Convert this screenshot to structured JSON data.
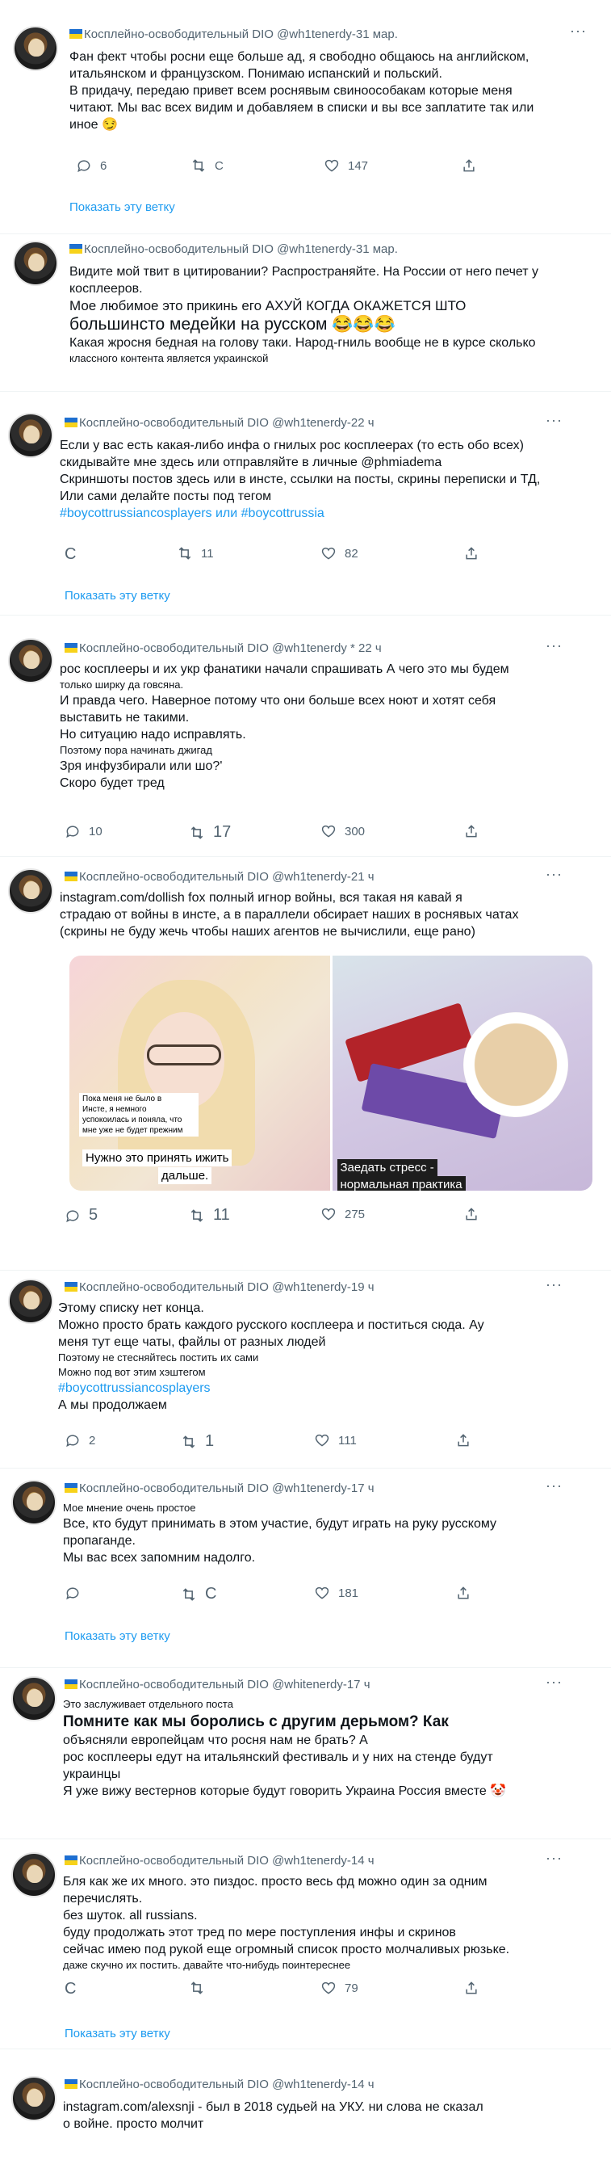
{
  "author": {
    "name": "Косплейно-освободительный DIO",
    "handles": [
      "@wh1tenerdy",
      "@whitenerdy"
    ]
  },
  "tweets": [
    {
      "header": "Косплейно-освободительный DIO @wh1tenerdy-31 мар.",
      "lines": [
        "Фан фект чтобы росни еще больше ад, я свободно общаюсь на английском,",
        "итальянском и французском. Понимаю испанский и польский.",
        "В придачу, передаю привет всем роснявым свиноособакам которые меня",
        "читают. Мы вас всех видим и добавляем в списки и вы все заплатите так или",
        "иное 😏"
      ],
      "counts": {
        "reply": "6",
        "retweet": "С",
        "like": "147"
      },
      "thread": "Показать эту ветку"
    },
    {
      "header": "Косплейно-освободительный DIO @wh1tenerdy-31 мар.",
      "lines": [
        "Видите мой твит в цитировании? Распространяйте. На России от него печет у",
        "косплееров.",
        "Мое любимое это прикинь его АХУЙ КОГДА ОКАЖЕТСЯ ШТО",
        "большинсто медейки на русском 😂😂😂",
        "Какая жросня бедная на голову таки. Народ-гниль вообще не в курсе сколько",
        "классного контента является украинской"
      ]
    },
    {
      "header": "Косплейно-освободительный DIO @wh1tenerdy-22 ч",
      "lines": [
        "Если у вас есть какая-либо инфа о гнилых рос косплеерах (то есть обо всех)",
        "скидывайте мне здесь или отправляйте в личные @phmiadema",
        "Скриншоты постов здесь или в инсте, ссылки на посты, скрины переписки и ТД,",
        "Или сами делайте посты под тегом",
        "#boycottrussiancosplayers или #boycottrussia"
      ],
      "counts": {
        "reply": "C",
        "retweet": "11",
        "like": "82"
      },
      "thread": "Показать эту ветку"
    },
    {
      "header": "Косплейно-освободительный DIO @wh1tenerdy * 22 ч",
      "lines": [
        "рос косплееры и их укр фанатики начали спрашивать А чего это мы будем",
        "только ширку да говсяна.",
        "И правда чего. Наверное потому что они больше всех ноют и хотят себя",
        "выставить не такими.",
        "Но ситуацию надо исправлять.",
        "Поэтому пора начинать джигад",
        "Зря инфузбирали или шо?'",
        "Скоро будет тред"
      ],
      "counts": {
        "reply": "10",
        "retweet": "17",
        "like": "300"
      }
    },
    {
      "header": "Косплейно-освободительный DIO @wh1tenerdy-21 ч",
      "lines": [
        "instagram.com/dollish fox полный игнор войны, вся такая ня кавай я",
        "страдаю от войны в инсте, а в параллели обсирает наших в роснявых чатах",
        "(скрины не буду жечь чтобы наших агентов не вычислили, еще рано)"
      ],
      "photo_captions": {
        "left_small": [
          "Пока меня не было в",
          "Инсте, я немного",
          "успокоилась и поняла, что",
          "мне уже не будет прежним"
        ],
        "left_big_1": "Нужно это принять",
        "left_big_2": "ижить",
        "left_big_3": "дальше.",
        "right_1": "Заедать стресс -",
        "right_2": "нормальная практика"
      },
      "counts": {
        "reply": "5",
        "retweet": "11",
        "like": "275"
      }
    },
    {
      "header": "Косплейно-освободительный DIO @wh1tenerdy-19 ч",
      "lines": [
        "Этому списку нет конца.",
        "Можно просто брать каждого русского косплеера и поститься сюда. Ау",
        "меня тут еще чаты, файлы от разных людей",
        "Поэтому не стесняйтесь постить их сами",
        "Можно под вот этим хэштегом",
        "#boycottrussiancosplayers",
        "А мы продолжаем"
      ],
      "counts": {
        "reply": "2",
        "retweet": "1",
        "like": "111"
      }
    },
    {
      "header": "Косплейно-освободительный DIO @wh1tenerdy-17 ч",
      "lines": [
        "Мое мнение очень простое",
        "Все, кто будут принимать в этом участие, будут играть на руку русскому",
        "пропаганде.",
        "Мы вас всех запомним надолго."
      ],
      "counts": {
        "reply": "",
        "retweet": "С",
        "like": "181"
      },
      "thread": "Показать эту ветку"
    },
    {
      "header": "Косплейно-освободительный DIO @whitenerdy-17 ч",
      "lines": [
        "Это заслуживает отдельного поста",
        "Помните как мы боролись с другим дерьмом? Как",
        "объясняли европейцам что росня нам не брать? А",
        "рос косплееры едут на итальянский фестиваль и у них на стенде будут",
        "украинцы",
        "Я уже вижу вестернов которые будут говорить Украина Россия вместе 🤡"
      ]
    },
    {
      "header": "Косплейно-освободительный DIO @wh1tenerdy-14 ч",
      "lines": [
        "Бля как же их много. это пиздос. просто весь фд можно один за одним",
        "перечислять.",
        "без шуток. all russians.",
        "буду продолжать этот тред по мере поступления инфы и скринов",
        "сейчас имею под рукой еще огромный список просто молчаливых рюзьке.",
        "даже скучно их постить. давайте что-нибудь поинтереснее"
      ],
      "counts": {
        "reply": "C",
        "retweet": "",
        "like": "79"
      },
      "thread": "Показать эту ветку"
    },
    {
      "header": "Косплейно-освободительный DIO @wh1tenerdy-14 ч",
      "lines": [
        "instagram.com/alexsnji - был в 2018 судьей на УКУ. ни слова не сказал",
        "о войне. просто молчит"
      ]
    }
  ],
  "more_label": "···"
}
